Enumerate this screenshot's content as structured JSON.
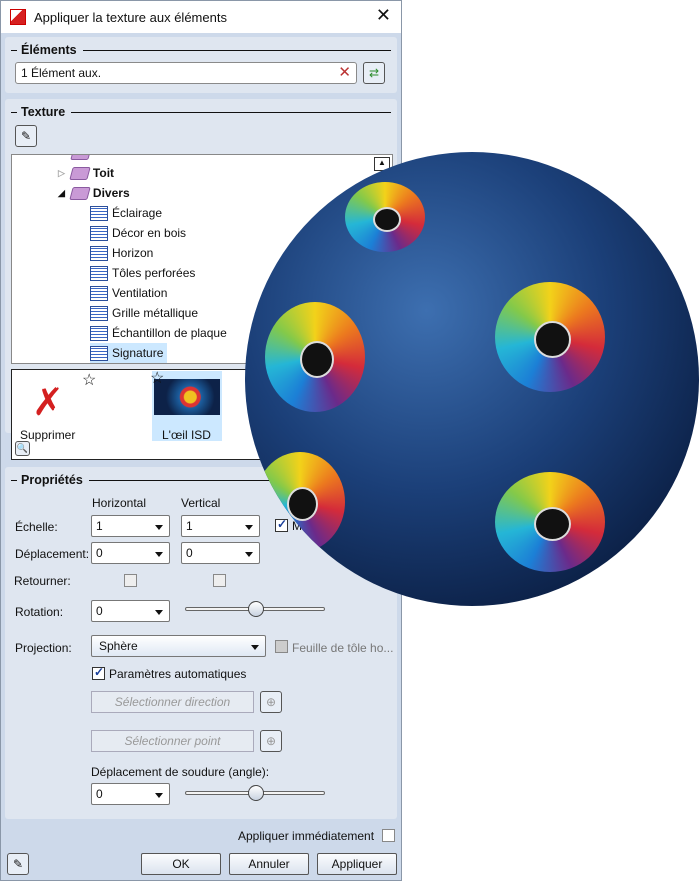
{
  "window": {
    "title": "Appliquer la texture aux éléments",
    "close_icon": "close-icon"
  },
  "elements": {
    "header": "Éléments",
    "value": "1 Élément aux."
  },
  "texture": {
    "header": "Texture",
    "tree": [
      {
        "label": "Toit",
        "bold": true
      },
      {
        "label": "Divers",
        "bold": true
      },
      {
        "label": "Éclairage"
      },
      {
        "label": "Décor en bois"
      },
      {
        "label": "Horizon"
      },
      {
        "label": "Tôles perforées"
      },
      {
        "label": "Ventilation"
      },
      {
        "label": "Grille métallique"
      },
      {
        "label": "Échantillon de plaque"
      },
      {
        "label": "Signature",
        "selected": true
      }
    ],
    "thumbnails": [
      {
        "label": "Supprimer"
      },
      {
        "label": "L'œil ISD",
        "selected": true
      }
    ]
  },
  "properties": {
    "header": "Propriétés",
    "col_horizontal": "Horizontal",
    "col_vertical": "Vertical",
    "scale_label": "Échelle:",
    "scale_h": "1",
    "scale_v": "1",
    "scale_link_label": "M",
    "offset_label": "Déplacement:",
    "offset_h": "0",
    "offset_v": "0",
    "flip_label": "Retourner:",
    "rotation_label": "Rotation:",
    "rotation": "0",
    "rotation_slider": 0.5,
    "projection_label": "Projection:",
    "projection": "Sphère",
    "sheet_label": "Feuille de tôle ho...",
    "auto_params_label": "Paramètres automatiques",
    "select_direction": "Sélectionner direction",
    "select_point": "Sélectionner point",
    "seam_label": "Déplacement de soudure (angle):",
    "seam": "0",
    "seam_slider": 0.5
  },
  "footer": {
    "apply_immediately": "Appliquer immédiatement",
    "ok": "OK",
    "cancel": "Annuler",
    "apply": "Appliquer"
  },
  "colors": {
    "dialog_bg": "#cdd9ea",
    "selection": "#cce8ff",
    "sphere": "#1b3f78"
  }
}
